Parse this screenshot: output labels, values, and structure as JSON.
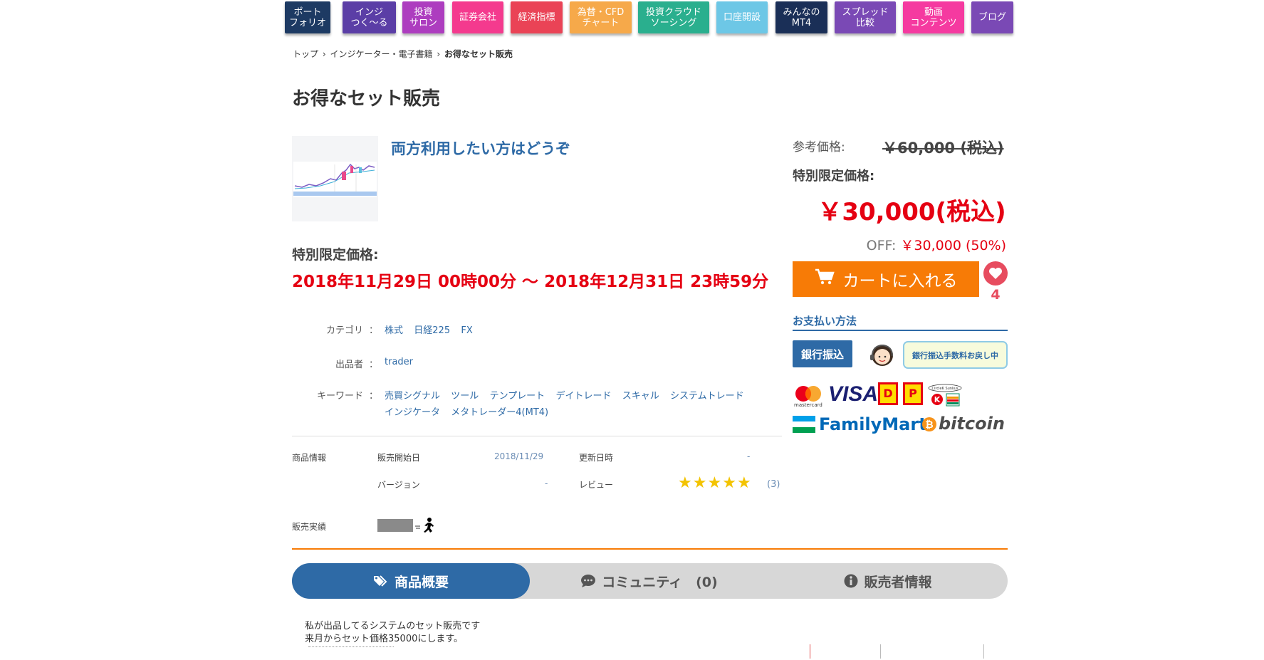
{
  "nav": [
    {
      "label": "ポート\nフォリオ",
      "color": "#1d3a63"
    },
    {
      "label": "インジ\nつく～る",
      "color": "#5b3ea6"
    },
    {
      "label": "投資\nサロン",
      "color": "#ad3dbf"
    },
    {
      "label": "証券会社",
      "color": "#f43a8e"
    },
    {
      "label": "経済指標",
      "color": "#ea4356"
    },
    {
      "label": "為替・CFD\nチャート",
      "color": "#f6a94a"
    },
    {
      "label": "投資クラウド\nソーシング",
      "color": "#2aaf8e"
    },
    {
      "label": "口座開設",
      "color": "#6dc7e6"
    },
    {
      "label": "みんなの\nMT4",
      "color": "#1a2f57"
    },
    {
      "label": "スプレッド\n比較",
      "color": "#7a49b5"
    },
    {
      "label": "動画\nコンテンツ",
      "color": "#f53aa0"
    },
    {
      "label": "ブログ",
      "color": "#7a49b5"
    }
  ],
  "breadcrumb": {
    "items": [
      "トップ",
      "インジケーター・電子書籍",
      "お得なセット販売"
    ],
    "sep": "›"
  },
  "page_title": "お得なセット販売",
  "product": {
    "link_text": "両方利用したい方はどうぞ",
    "period_label": "特別限定価格:",
    "period": "2018年11月29日 00時00分 ～ 2018年12月31日 23時59分",
    "category_label": "カテゴリ",
    "colon": "：",
    "categories": [
      "株式",
      "日経225",
      "FX"
    ],
    "seller_label": "出品者",
    "seller": "trader",
    "keyword_label": "キーワード",
    "keywords_line1": [
      "売買シグナル",
      "ツール",
      "テンプレート",
      "デイトレード",
      "スキャル",
      "システムトレード"
    ],
    "keywords_line2": [
      "インジケータ",
      "メタトレーダー4(MT4)"
    ]
  },
  "info": {
    "section_label": "商品情報",
    "start_label": "販売開始日",
    "start_value": "2018/11/29",
    "updated_label": "更新日時",
    "updated_value": "-",
    "version_label": "バージョン",
    "version_value": "-",
    "review_label": "レビュー",
    "review_stars": 5,
    "review_count": "(3)",
    "sales_label": "販売実績",
    "star_color": "#f3c300"
  },
  "price": {
    "ref_label": "参考価格:",
    "ref_price": "￥60,000 (税込)",
    "special_label": "特別限定価格:",
    "special_price": "￥30,000(税込)",
    "off_label": "OFF:",
    "off_value": "￥30,000 (50%)",
    "cart_label": "カートに入れる",
    "favorite_count": "4"
  },
  "payment": {
    "title": "お支払い方法",
    "bank_button": "銀行振込",
    "bubble": "銀行振込手数料お戻し中",
    "visa": "VISA",
    "mastercard": "mastercard",
    "familymart": "FamilyMart",
    "bitcoin": "bitcoin",
    "circlek": "CircleK Sunkus"
  },
  "tabs": [
    {
      "label": "商品概要",
      "active": true
    },
    {
      "label": "コミュニティ　(0)",
      "active": false
    },
    {
      "label": "販売者情報",
      "active": false
    }
  ],
  "description": [
    "私が出品してるシステムのセット販売です",
    "来月からセット価格35000にします。"
  ],
  "colors": {
    "accent_blue": "#2e6aa6",
    "price_red": "#e50012",
    "cart_orange": "#f77b06",
    "heart_pink": "#e74c5f"
  }
}
